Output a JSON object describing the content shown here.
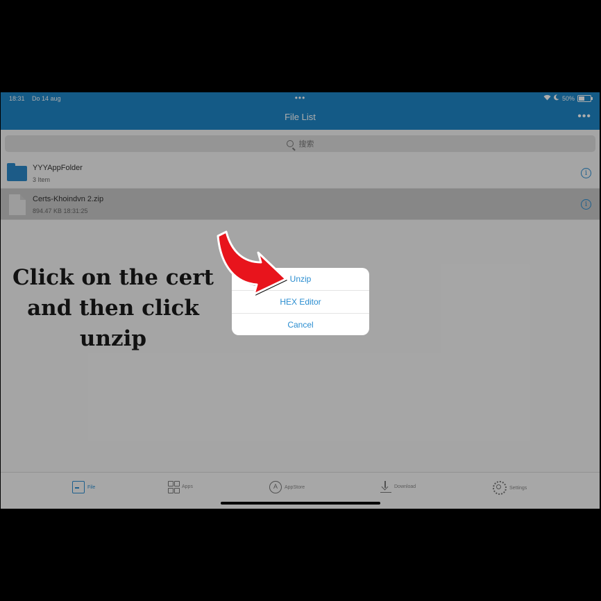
{
  "status_bar": {
    "time": "18:31",
    "date": "Do 14 aug",
    "center_dots": "•••",
    "battery": "50%"
  },
  "nav": {
    "title": "File List",
    "more": "•••"
  },
  "search": {
    "placeholder": "搜索"
  },
  "files": [
    {
      "name": "YYYAppFolder",
      "meta": "3 Item",
      "type": "folder",
      "selected": false
    },
    {
      "name": "Certs-Khoindvn 2.zip",
      "meta": "894.47 KB   18:31:25",
      "type": "zip",
      "selected": true
    }
  ],
  "action_sheet": {
    "options": [
      "Unzip",
      "HEX Editor",
      "Cancel"
    ]
  },
  "annotation": {
    "lines": [
      "Click on the cert",
      "and then click",
      "unzip"
    ]
  },
  "tabs": [
    {
      "label": "File",
      "icon": "file-icon",
      "active": true
    },
    {
      "label": "Apps",
      "icon": "apps-grid-icon",
      "active": false
    },
    {
      "label": "AppStore",
      "icon": "appstore-icon",
      "active": false
    },
    {
      "label": "Download",
      "icon": "download-icon",
      "active": false
    },
    {
      "label": "Settings",
      "icon": "gear-icon",
      "active": false
    }
  ],
  "colors": {
    "accent": "#1e85c6",
    "annotation_arrow": "#e8141c"
  }
}
